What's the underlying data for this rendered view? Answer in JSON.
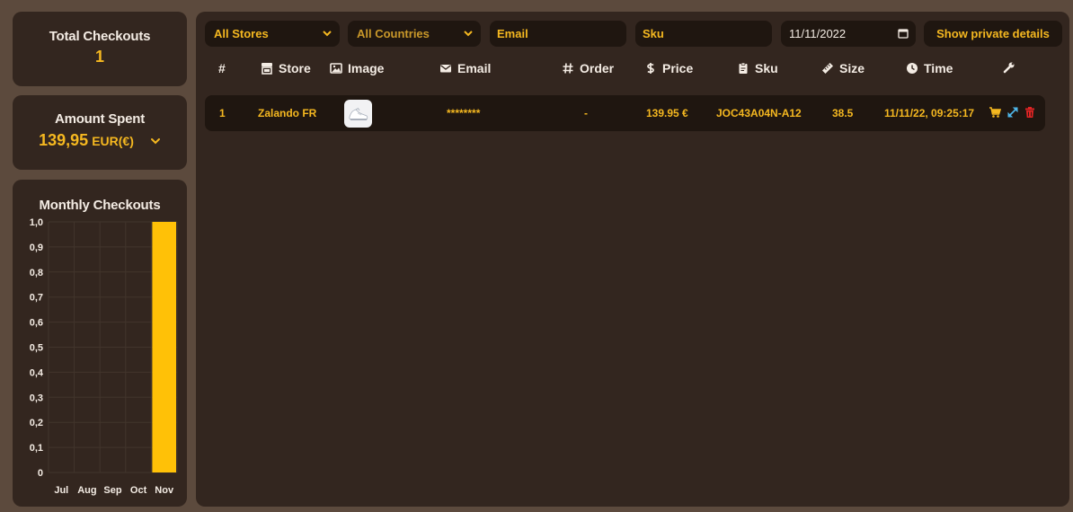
{
  "stats": {
    "total_checkouts_label": "Total Checkouts",
    "total_checkouts_value": "1",
    "amount_spent_label": "Amount Spent",
    "amount_spent_value": "139,95",
    "amount_spent_currency": "EUR(€)"
  },
  "chart_data": {
    "type": "bar",
    "title": "Monthly Checkouts",
    "categories": [
      "Jul",
      "Aug",
      "Sep",
      "Oct",
      "Nov"
    ],
    "values": [
      0,
      0,
      0,
      0,
      1
    ],
    "ylim": [
      0,
      1
    ],
    "yticks": [
      "0",
      "0,1",
      "0,2",
      "0,3",
      "0,4",
      "0,5",
      "0,6",
      "0,7",
      "0,8",
      "0,9",
      "1,0"
    ],
    "grid": true,
    "bar_color": "#ffc107"
  },
  "filters": {
    "store_selected": "All Stores",
    "country_selected": "All Countries",
    "email_placeholder": "Email",
    "sku_placeholder": "Sku",
    "date_value": "11/11/2022",
    "private_button_label": "Show private details"
  },
  "table": {
    "headers": {
      "index": "#",
      "store": "Store",
      "image": "Image",
      "email": "Email",
      "order": "Order",
      "price": "Price",
      "sku": "Sku",
      "size": "Size",
      "time": "Time"
    },
    "header_icons": [
      "store-icon",
      "image-icon",
      "envelope-icon",
      "hashtag-icon",
      "dollar-icon",
      "tag-icon",
      "ruler-icon",
      "clock-icon",
      "wrench-icon"
    ],
    "rows": [
      {
        "index": "1",
        "store": "Zalando FR",
        "email": "********",
        "order": "-",
        "price": "139.95 €",
        "sku": "JOC43A04N-A12",
        "size": "38.5",
        "time": "11/11/22, 09:25:17"
      }
    ],
    "row_action_icons": [
      "cart-icon",
      "expand-icon",
      "trash-icon"
    ]
  },
  "colors": {
    "background": "#5c4a3d",
    "panel": "#33261f",
    "input": "#1f1610",
    "accent": "#f5b820",
    "expand": "#4fb6e8",
    "danger": "#e02424"
  }
}
